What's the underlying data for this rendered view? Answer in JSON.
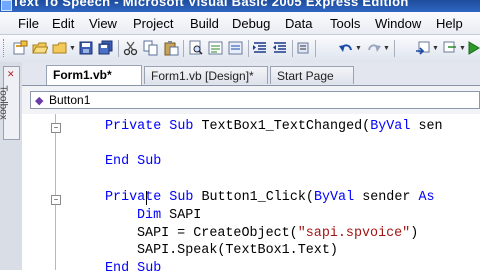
{
  "window": {
    "title": "Text To Speech - Microsoft Visual Basic 2005 Express Edition"
  },
  "menu": [
    "File",
    "Edit",
    "View",
    "Project",
    "Build",
    "Debug",
    "Data",
    "Tools",
    "Window",
    "Help"
  ],
  "toolbar": {
    "icons": [
      "new-project-icon",
      "open-file-icon",
      "save-icon",
      "save-all-icon",
      "cut-icon",
      "copy-icon",
      "paste-icon",
      "find-icon",
      "comment-icon",
      "uncomment-icon",
      "indent-icon",
      "outdent-icon",
      "undo-icon",
      "redo-icon",
      "navigate-back-icon",
      "navigate-forward-icon",
      "start-debug-icon"
    ]
  },
  "sidebar": {
    "toolbox_label": "Toolbox"
  },
  "tabs": [
    {
      "label": "Form1.vb*",
      "active": true
    },
    {
      "label": "Form1.vb [Design]*",
      "active": false
    },
    {
      "label": "Start Page",
      "active": false
    }
  ],
  "navigation": {
    "object": "Button1"
  },
  "code": {
    "line1": {
      "kw1": "Private",
      "kw2": "Sub",
      "text": "TextBox1_TextChanged(",
      "kw3": "ByVal",
      "rest": "sen"
    },
    "line2": {
      "kw1": "End",
      "kw2": "Sub"
    },
    "line3": {
      "kw1": "Private",
      "kw2": "Sub",
      "text": "Button1_Click(",
      "kw3": "ByVal",
      "rest": "sender",
      "kw4": "As"
    },
    "line4": {
      "kw1": "Dim",
      "text": "SAPI"
    },
    "line5": {
      "text": "SAPI = CreateObject(",
      "str": "\"sapi.spvoice\"",
      "rest": ")"
    },
    "line6": {
      "text": "SAPI.Speak(TextBox1.Text)"
    },
    "line7": {
      "kw1": "End",
      "kw2": "Sub"
    }
  }
}
